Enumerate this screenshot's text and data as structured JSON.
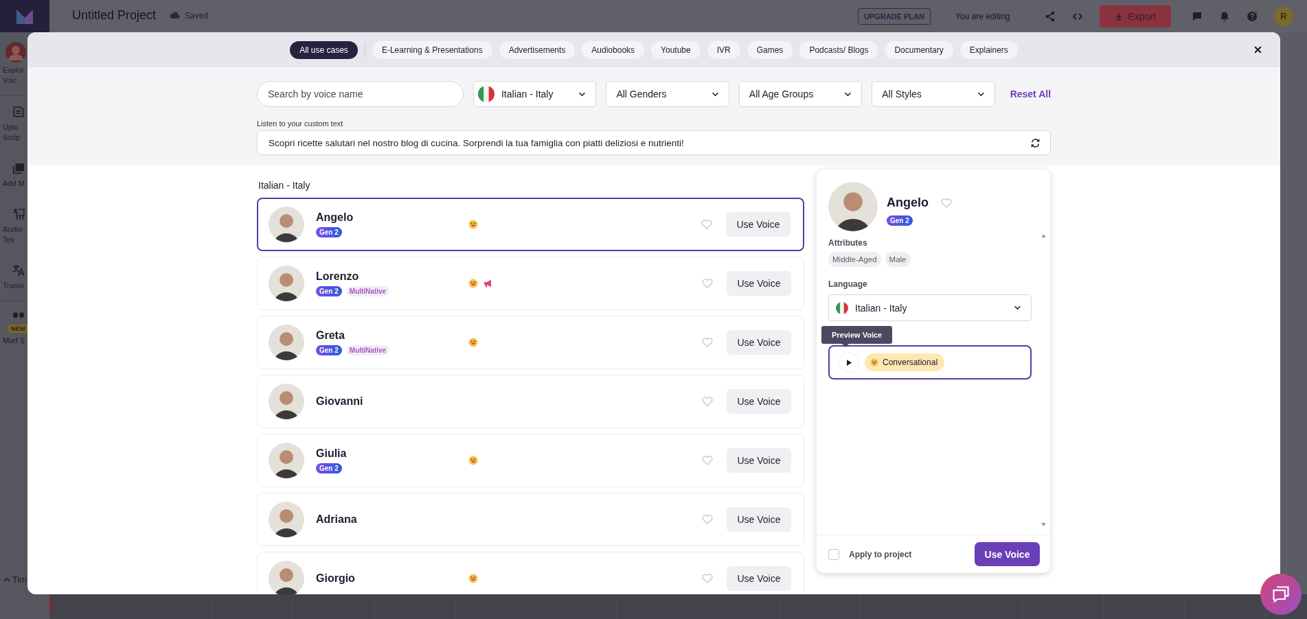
{
  "app": {
    "project_title": "Untitled Project",
    "save_status": "Saved",
    "upgrade_button": "UPGRADE PLAN",
    "editing_label": "You are editing",
    "export_button": "Export",
    "user_initial": "R"
  },
  "sidebar": {
    "items": [
      {
        "kind": "avatar",
        "lines": [
          "Explor",
          "Voic"
        ]
      },
      {
        "kind": "upload",
        "lines": [
          "Uplo",
          "Scrip"
        ]
      },
      {
        "kind": "media",
        "lines": [
          "Add M"
        ]
      },
      {
        "kind": "audio",
        "lines": [
          "Audio",
          "Tex"
        ]
      },
      {
        "kind": "translate",
        "lines": [
          "Transl"
        ]
      },
      {
        "kind": "studio",
        "badge": "NEW",
        "lines": [
          "Murf S"
        ]
      }
    ],
    "timeline_toggle": "Tim"
  },
  "modal": {
    "use_cases": [
      {
        "label": "All use cases",
        "selected": true
      },
      {
        "label": "E-Learning & Presentations",
        "selected": false
      },
      {
        "label": "Advertisements",
        "selected": false
      },
      {
        "label": "Audiobooks",
        "selected": false
      },
      {
        "label": "Youtube",
        "selected": false
      },
      {
        "label": "IVR",
        "selected": false
      },
      {
        "label": "Games",
        "selected": false
      },
      {
        "label": "Podcasts/ Blogs",
        "selected": false
      },
      {
        "label": "Documentary",
        "selected": false
      },
      {
        "label": "Explainers",
        "selected": false
      }
    ],
    "search": {
      "placeholder": "Search by voice name"
    },
    "filters": [
      {
        "kind": "language",
        "value": "Italian - Italy"
      },
      {
        "kind": "select",
        "value": "All Genders"
      },
      {
        "kind": "select",
        "value": "All Age Groups"
      },
      {
        "kind": "select",
        "value": "All Styles"
      }
    ],
    "reset": "Reset All",
    "custom_text_label": "Listen to your custom text",
    "custom_text": "Scopri ricette salutari nel nostro blog di cucina. Sorprendi la tua famiglia con piatti deliziosi e nutrienti!",
    "list_heading": "Italian - Italy",
    "voices": [
      {
        "name": "Angelo",
        "selected": true,
        "favorite": false,
        "badges": [
          {
            "kind": "gen",
            "label": "Gen 2"
          }
        ],
        "styles": [
          {
            "kind": "smile"
          }
        ],
        "action": "Use Voice"
      },
      {
        "name": "Lorenzo",
        "selected": false,
        "favorite": false,
        "badges": [
          {
            "kind": "gen",
            "label": "Gen 2"
          },
          {
            "kind": "multinative",
            "label": "MultiNative"
          }
        ],
        "styles": [
          {
            "kind": "smile"
          },
          {
            "kind": "megaphone"
          }
        ],
        "action": "Use Voice"
      },
      {
        "name": "Greta",
        "selected": false,
        "favorite": false,
        "badges": [
          {
            "kind": "gen",
            "label": "Gen 2"
          },
          {
            "kind": "multinative",
            "label": "MultiNative"
          }
        ],
        "styles": [
          {
            "kind": "smile"
          }
        ],
        "action": "Use Voice"
      },
      {
        "name": "Giovanni",
        "selected": false,
        "favorite": false,
        "action": "Use Voice"
      },
      {
        "name": "Giulia",
        "selected": false,
        "favorite": false,
        "badges": [
          {
            "kind": "gen",
            "label": "Gen 2"
          }
        ],
        "styles": [
          {
            "kind": "smile"
          }
        ],
        "action": "Use Voice"
      },
      {
        "name": "Adriana",
        "selected": false,
        "favorite": false,
        "action": "Use Voice"
      },
      {
        "name": "Giorgio",
        "selected": false,
        "favorite": false,
        "styles": [
          {
            "kind": "smile"
          }
        ],
        "action": "Use Voice"
      }
    ],
    "details": {
      "name": "Angelo",
      "favorite": false,
      "badge": {
        "kind": "gen",
        "label": "Gen 2"
      },
      "attributes_label": "Attributes",
      "attributes": [
        "Middle-Aged",
        "Male"
      ],
      "language_label": "Language",
      "language": "Italian - Italy",
      "tooltip": "Preview Voice",
      "styles": [
        {
          "kind": "smile",
          "label": "Conversational"
        }
      ],
      "apply_label": "Apply to project",
      "apply_checked": false,
      "action": "Use Voice"
    }
  }
}
